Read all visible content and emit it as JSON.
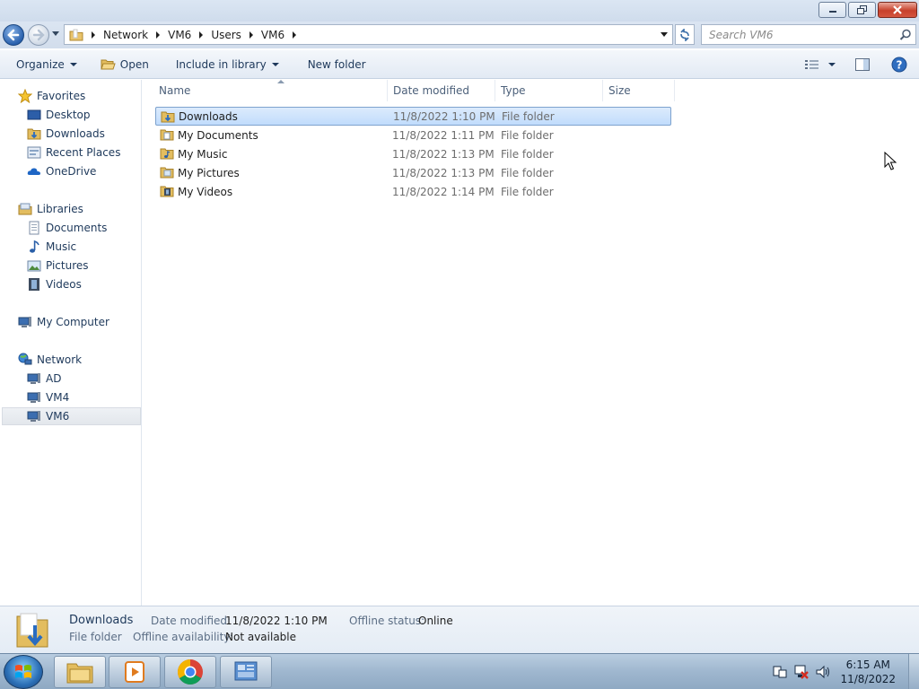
{
  "window": {
    "controls": {
      "minimize_icon": "minimize-icon",
      "maximize_icon": "restore-icon",
      "close_icon": "close-icon"
    }
  },
  "address_bar": {
    "breadcrumbs": [
      "Network",
      "VM6",
      "Users",
      "VM6"
    ]
  },
  "search": {
    "placeholder": "Search VM6"
  },
  "toolbar": {
    "organize": "Organize",
    "open": "Open",
    "include_in_library": "Include in library",
    "new_folder": "New folder"
  },
  "sidebar": {
    "favorites": {
      "title": "Favorites",
      "items": [
        "Desktop",
        "Downloads",
        "Recent Places",
        "OneDrive"
      ]
    },
    "libraries": {
      "title": "Libraries",
      "items": [
        "Documents",
        "Music",
        "Pictures",
        "Videos"
      ]
    },
    "computer": {
      "title": "My Computer"
    },
    "network": {
      "title": "Network",
      "items": [
        "AD",
        "VM4",
        "VM6"
      ],
      "selected": "VM6"
    }
  },
  "file_list": {
    "columns": [
      "Name",
      "Date modified",
      "Type",
      "Size"
    ],
    "rows": [
      {
        "name": "Downloads",
        "date": "11/8/2022 1:10 PM",
        "type": "File folder",
        "selected": true
      },
      {
        "name": "My Documents",
        "date": "11/8/2022 1:11 PM",
        "type": "File folder"
      },
      {
        "name": "My Music",
        "date": "11/8/2022 1:13 PM",
        "type": "File folder"
      },
      {
        "name": "My Pictures",
        "date": "11/8/2022 1:13 PM",
        "type": "File folder"
      },
      {
        "name": "My Videos",
        "date": "11/8/2022 1:14 PM",
        "type": "File folder"
      }
    ]
  },
  "details_pane": {
    "name": "Downloads",
    "kind": "File folder",
    "date_modified_label": "Date modified:",
    "date_modified_value": "11/8/2022 1:10 PM",
    "offline_status_label": "Offline status:",
    "offline_status_value": "Online",
    "offline_availability_label": "Offline availability:",
    "offline_availability_value": "Not available"
  },
  "taskbar": {
    "apps": [
      "windows-explorer",
      "media-player",
      "chrome",
      "control-panel"
    ],
    "clock_time": "6:15 AM",
    "clock_date": "11/8/2022"
  },
  "colors": {
    "selection": "#cce0fb",
    "selection_border": "#7da2ce",
    "text_primary": "#1e395b",
    "taskbar": "#9fb7cf"
  }
}
